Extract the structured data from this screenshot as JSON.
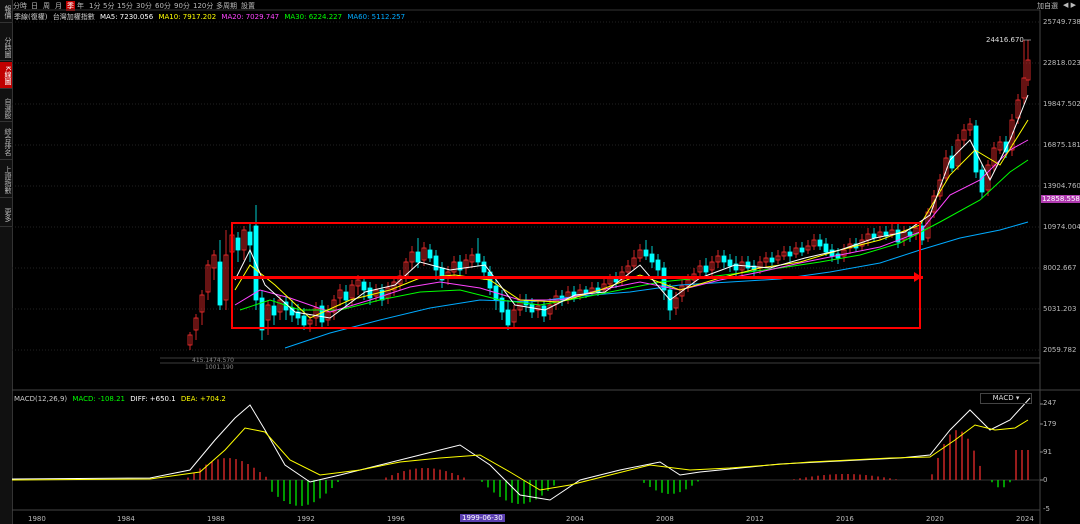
{
  "sidebar": {
    "items": [
      {
        "label": "報價"
      },
      {
        "label": "分時圖"
      },
      {
        "label": "K線圖",
        "active": true
      },
      {
        "label": "自選股"
      },
      {
        "label": "綜合排名"
      },
      {
        "label": "上證指數"
      },
      {
        "label": "更多"
      }
    ]
  },
  "toolbar": {
    "periods": [
      "分時",
      "日",
      "周",
      "月",
      "季",
      "年",
      "1分",
      "5分",
      "15分",
      "30分",
      "60分",
      "90分",
      "120分",
      "多周期",
      "設置"
    ],
    "active_period": "季"
  },
  "top_right": {
    "add_watchlist": "加自選"
  },
  "main_legend": {
    "name": "季線(復權)",
    "index_name": "台灣加權指數",
    "ma5": "MA5: 7230.056",
    "ma10": "MA10: 7917.202",
    "ma20": "MA20: 7029.747",
    "ma30": "MA30: 6224.227",
    "ma60": "MA60: 5112.257"
  },
  "y_axis_labels": [
    "25749.738",
    "22818.023",
    "19847.502",
    "16875.181",
    "13904.760",
    "10974.004",
    "8002.667",
    "5031.203",
    "2059.782"
  ],
  "current_price_label": "12858.558",
  "peak_label": "24416.670",
  "low_labels": [
    "415.1474.570",
    "1001.190"
  ],
  "x_axis_labels": [
    "1980",
    "1984",
    "1988",
    "1992",
    "1996",
    "2004",
    "2008",
    "2012",
    "2016",
    "2020",
    "2024"
  ],
  "date_marker": "1999-06-30",
  "macd_panel": {
    "title": "MACD(12,26,9)",
    "macd": "MACD: -108.21",
    "diff": "DIFF: +650.1",
    "dea": "DEA: +704.2",
    "button": "MACD",
    "y_labels": [
      "247",
      "179",
      "91",
      "0",
      "-5"
    ]
  },
  "colors": {
    "up": "#ff3030",
    "down": "#00ffff",
    "ma5": "#ffffff",
    "ma10": "#ffff00",
    "ma20": "#ff00ff",
    "ma30": "#00ff00",
    "ma60": "#00aaff",
    "annotation": "#ff0000"
  }
}
